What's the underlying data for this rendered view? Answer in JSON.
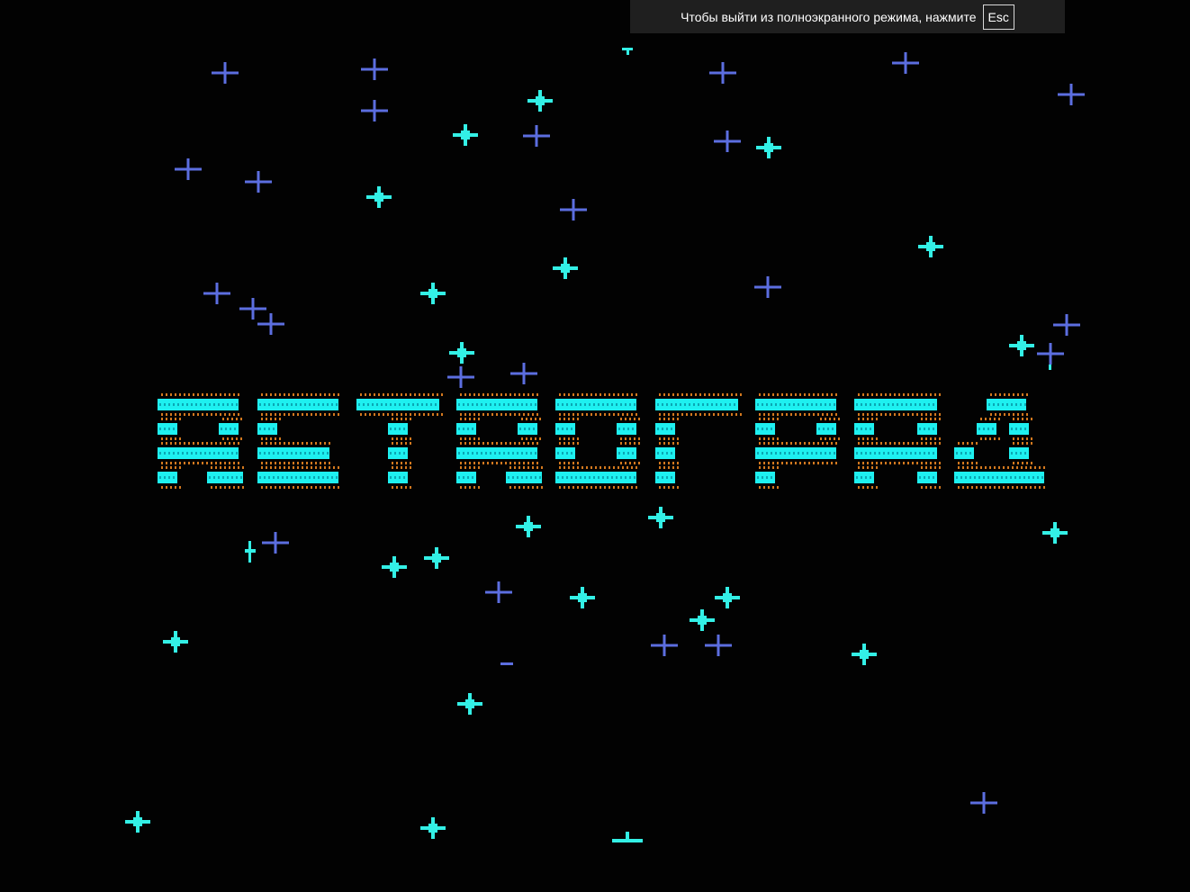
{
  "fullscreen_notice": {
    "message": "Чтобы выйти из полноэкранного режима, нажмите",
    "key_label": "Esc"
  },
  "game": {
    "title": "RETROГРАД",
    "colors": {
      "background": "#020202",
      "logo_fill": "#1ef0f0",
      "logo_shadow": "#d2781e",
      "star_cyan": "#33f0e6",
      "star_blue": "#5c6ee0"
    },
    "icons": [
      "cyan-star-icon",
      "blue-cross-star-icon"
    ]
  }
}
